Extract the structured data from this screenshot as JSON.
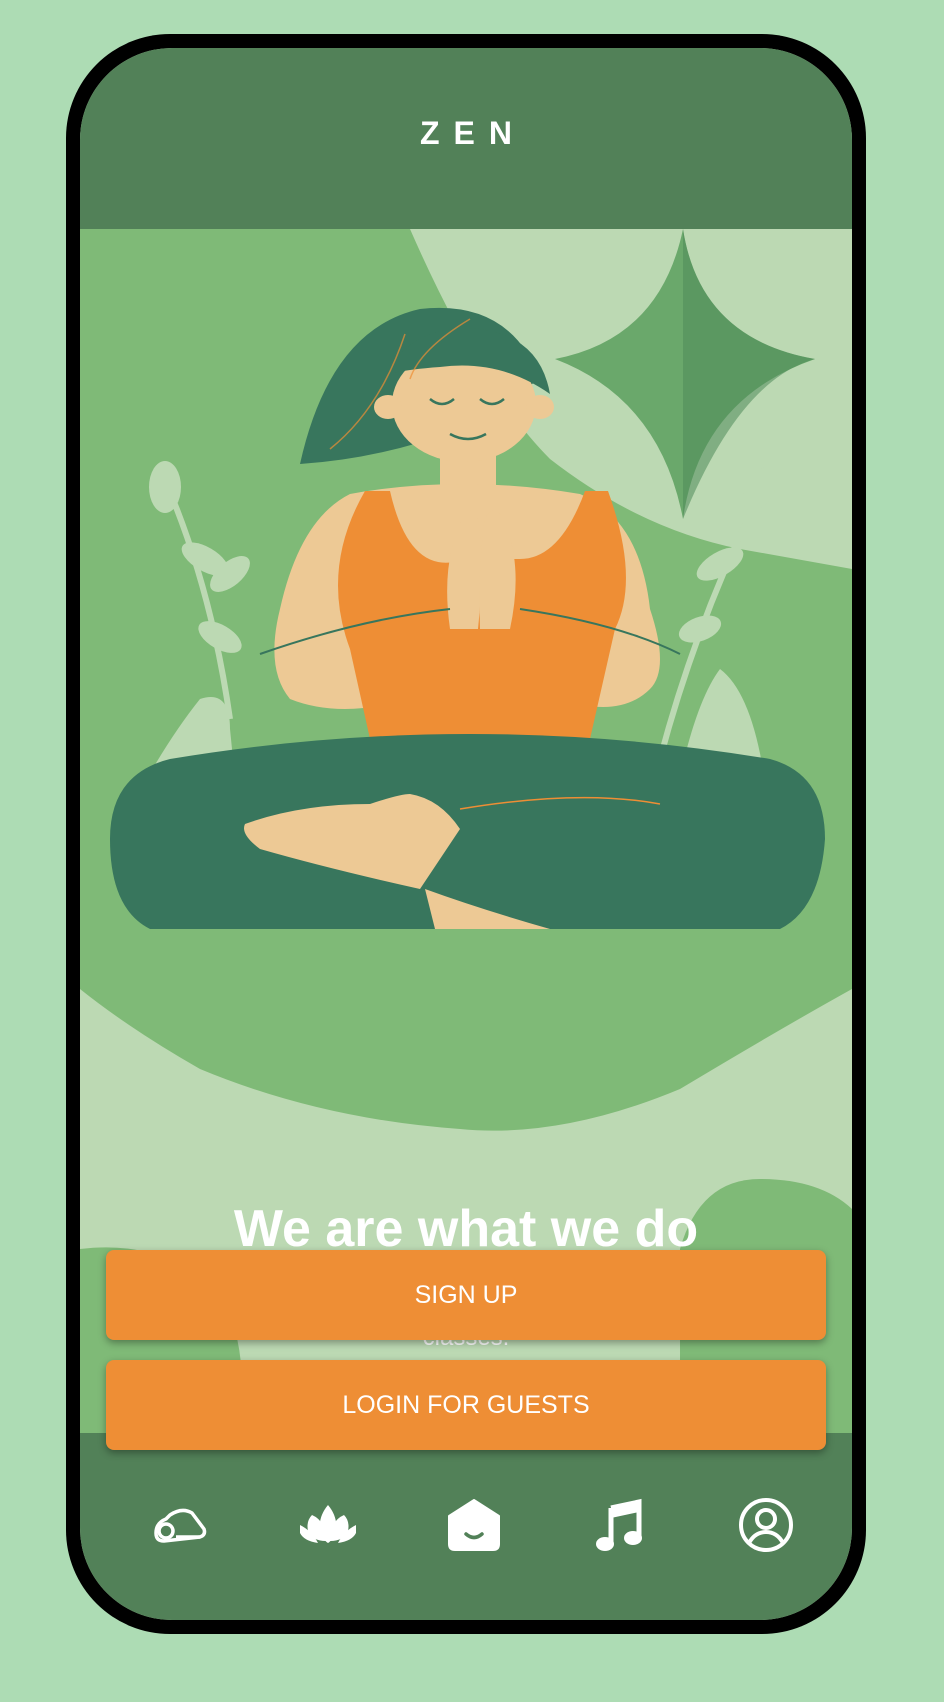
{
  "app": {
    "title": "ZEN"
  },
  "hero": {
    "headline": "We are what we do",
    "subtitle": "Thousands of people are using zen for meditation and yoga classes."
  },
  "actions": {
    "signup_label": "SIGN UP",
    "guest_label": "LOGIN FOR GUESTS"
  },
  "nav": {
    "items": [
      {
        "icon": "yoga-mat-icon",
        "active": false
      },
      {
        "icon": "lotus-icon",
        "active": false
      },
      {
        "icon": "home-icon",
        "active": true
      },
      {
        "icon": "music-note-icon",
        "active": false
      },
      {
        "icon": "profile-icon",
        "active": false
      }
    ]
  },
  "colors": {
    "background": "#addcb4",
    "bar": "#528158",
    "accent": "#ee8e35",
    "leaf_dark": "#38765d",
    "leaf_mid": "#7fba77",
    "leaf_light": "#bcd9b3",
    "skin": "#edc995"
  }
}
